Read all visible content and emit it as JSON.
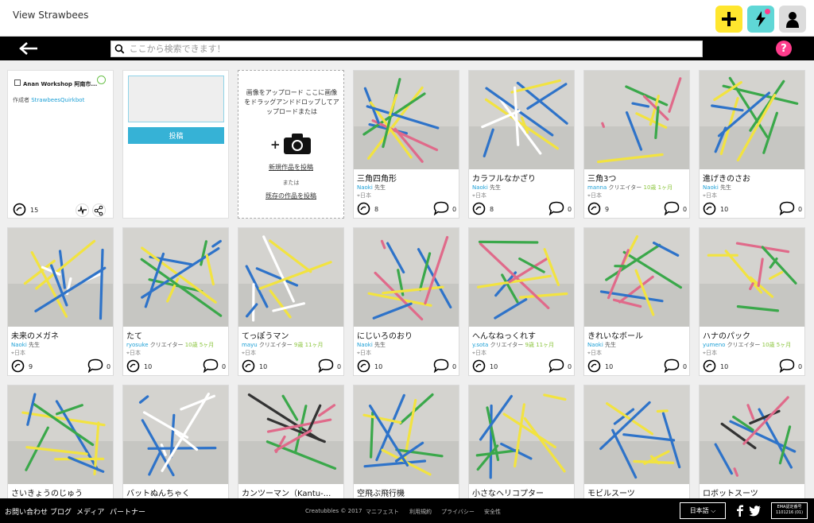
{
  "header": {
    "title": "View Strawbees"
  },
  "search": {
    "placeholder": "ここから検索できます！"
  },
  "gallery": {
    "name": "Anan Workshop 阿南市...",
    "by_label": "作成者",
    "owner": "StrawbeesQuirkbot",
    "bubbles": "15"
  },
  "post": {
    "button": "投稿"
  },
  "upload": {
    "text": "画像をアップロード ここに画像をドラッグアンドドロップしてアップロードまたは",
    "new_link": "新規作品を投稿",
    "or": "または",
    "existing_link": "既存の作品を投稿"
  },
  "cards": [
    {
      "title": "三角四角形",
      "author": "Naoki",
      "role": "先生",
      "age": "",
      "loc": "日本",
      "bubbles": "8",
      "comments": "0"
    },
    {
      "title": "カラフルなかざり",
      "author": "Naoki",
      "role": "先生",
      "age": "",
      "loc": "日本",
      "bubbles": "8",
      "comments": "0"
    },
    {
      "title": "三角3つ",
      "author": "manna",
      "role": "クリエイター",
      "age": "10歳 1ヶ月",
      "loc": "日本",
      "bubbles": "9",
      "comments": "0"
    },
    {
      "title": "進げきのさお",
      "author": "Naoki",
      "role": "先生",
      "age": "",
      "loc": "日本",
      "bubbles": "10",
      "comments": "0"
    },
    {
      "title": "未来のメガネ",
      "author": "Naoki",
      "role": "先生",
      "age": "",
      "loc": "日本",
      "bubbles": "9",
      "comments": "0"
    },
    {
      "title": "たて",
      "author": "ryosuke",
      "role": "クリエイター",
      "age": "10歳 5ヶ月",
      "loc": "日本",
      "bubbles": "10",
      "comments": "0"
    },
    {
      "title": "てっぽうマン",
      "author": "mayu",
      "role": "クリエイター",
      "age": "9歳 11ヶ月",
      "loc": "日本",
      "bubbles": "10",
      "comments": "0"
    },
    {
      "title": "にじいろのおり",
      "author": "Naoki",
      "role": "先生",
      "age": "",
      "loc": "日本",
      "bubbles": "10",
      "comments": "0"
    },
    {
      "title": "へんなねっくれす",
      "author": "y.sota",
      "role": "クリエイター",
      "age": "9歳 11ヶ月",
      "loc": "日本",
      "bubbles": "10",
      "comments": "0"
    },
    {
      "title": "きれいなボール",
      "author": "Naoki",
      "role": "先生",
      "age": "",
      "loc": "日本",
      "bubbles": "10",
      "comments": "0"
    },
    {
      "title": "ハナのパック",
      "author": "yumeno",
      "role": "クリエイター",
      "age": "10歳 5ヶ月",
      "loc": "日本",
      "bubbles": "10",
      "comments": "0"
    },
    {
      "title": "さいきょうのじゅう",
      "author": "",
      "role": "",
      "age": "",
      "loc": "",
      "bubbles": "",
      "comments": ""
    },
    {
      "title": "バットぬんちゃく",
      "author": "",
      "role": "",
      "age": "",
      "loc": "",
      "bubbles": "",
      "comments": ""
    },
    {
      "title": "カンツーマン（Kantu-...",
      "author": "",
      "role": "",
      "age": "",
      "loc": "",
      "bubbles": "",
      "comments": ""
    },
    {
      "title": "空飛ぶ飛行機",
      "author": "",
      "role": "",
      "age": "",
      "loc": "",
      "bubbles": "",
      "comments": ""
    },
    {
      "title": "小さなヘリコプター",
      "author": "",
      "role": "",
      "age": "",
      "loc": "",
      "bubbles": "",
      "comments": ""
    },
    {
      "title": "モビルスーツ",
      "author": "",
      "role": "",
      "age": "",
      "loc": "",
      "bubbles": "",
      "comments": ""
    },
    {
      "title": "ロボットスーツ",
      "author": "",
      "role": "",
      "age": "",
      "loc": "",
      "bubbles": "",
      "comments": ""
    }
  ],
  "footer": {
    "links": [
      "お問い合わせ",
      "ブログ",
      "メディア",
      "パートナー"
    ],
    "copyright": "Creatubbles © 2017",
    "center_links": [
      "マニフェスト",
      "利用規約",
      "プライバシー",
      "安全性"
    ],
    "language": "日本語",
    "ema": "EMA認定番号 1101216 (01)"
  },
  "colors": {
    "accent_yellow": "#ffe62e",
    "accent_teal": "#5fd7d6",
    "accent_pink": "#ff3c8c",
    "link_blue": "#1ea0d6",
    "age_green": "#8cc63f",
    "post_blue": "#36b2d6"
  }
}
